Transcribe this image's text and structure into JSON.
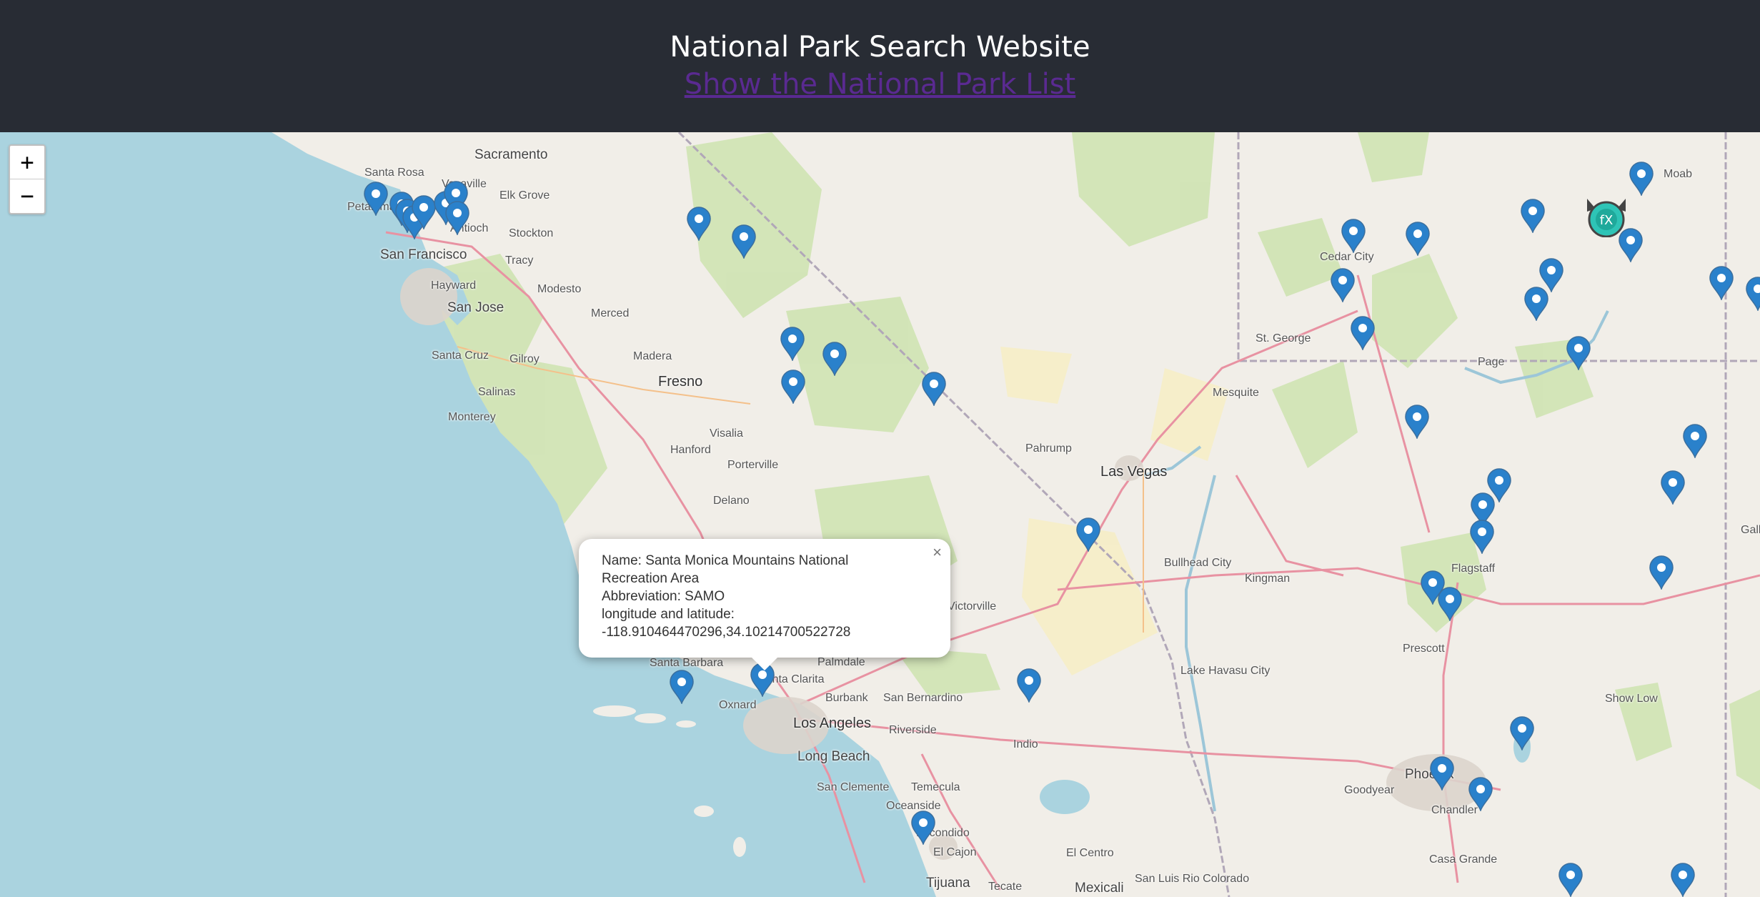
{
  "header": {
    "title": "National Park Search Website",
    "list_link": "Show the National Park List"
  },
  "zoom": {
    "in_label": "+",
    "out_label": "−"
  },
  "map_labels": [
    "Sacramento",
    "Santa Rosa",
    "Vacaville",
    "Elk Grove",
    "Petaluma",
    "Antioch",
    "Stockton",
    "San Francisco",
    "Tracy",
    "Hayward",
    "San Jose",
    "Modesto",
    "Merced",
    "Santa Cruz",
    "Gilroy",
    "Madera",
    "Fresno",
    "Salinas",
    "Monterey",
    "Visalia",
    "Hanford",
    "Porterville",
    "Delano",
    "Santa Barbara",
    "Oxnard",
    "Santa Clarita",
    "Palmdale",
    "Burbank",
    "San Bernardino",
    "Los Angeles",
    "Long Beach",
    "Riverside",
    "Indio",
    "San Clemente",
    "Temecula",
    "Oceanside",
    "Escondido",
    "El Cajon",
    "Tijuana",
    "Tecate",
    "Mexicali",
    "El Centro",
    "San Luis Rio Colorado",
    "Pahrump",
    "Las Vegas",
    "Bullhead City",
    "Kingman",
    "Lake Havasu City",
    "Prescott",
    "Flagstaff",
    "Mesquite",
    "St. George",
    "Cedar City",
    "Page",
    "Moab",
    "Show Low",
    "Phoenix",
    "Goodyear",
    "Chandler",
    "Casa Grande",
    "Gallup",
    "Victorville"
  ],
  "popup": {
    "name": "Name: Santa Monica Mountains National Recreation Area",
    "abbreviation": "Abbreviation: SAMO",
    "coords_label": "longitude and latitude:",
    "coords_value": "-118.910464470296,34.10214700522728",
    "close": "×"
  },
  "colors": {
    "header_bg": "#282c34",
    "link": "#5a2a91",
    "water": "#aad3df",
    "land": "#f1eee8",
    "marker": "#2a81cb"
  }
}
